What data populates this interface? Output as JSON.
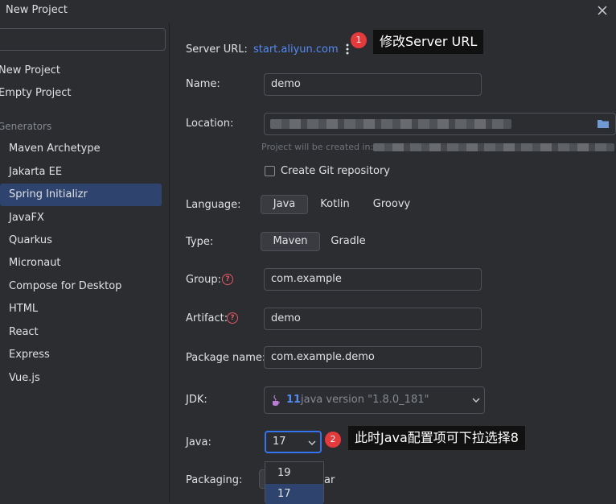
{
  "window": {
    "title": "New Project"
  },
  "sidebar": {
    "top_items": [
      "New Project",
      "Empty Project"
    ],
    "generators_label": "Generators",
    "generators": [
      "Maven Archetype",
      "Jakarta EE",
      "Spring Initializr",
      "JavaFX",
      "Quarkus",
      "Micronaut",
      "Compose for Desktop",
      "HTML",
      "React",
      "Express",
      "Vue.js"
    ],
    "selected": "Spring Initializr"
  },
  "form": {
    "server_url_label": "Server URL:",
    "server_url_value": "start.aliyun.com",
    "name_label": "Name:",
    "name_value": "demo",
    "location_label": "Location:",
    "location_hint": "Project will be created in:",
    "git_label": "Create Git repository",
    "language_label": "Language:",
    "languages": [
      "Java",
      "Kotlin",
      "Groovy"
    ],
    "language_selected": "Java",
    "type_label": "Type:",
    "types": [
      "Maven",
      "Gradle"
    ],
    "type_selected": "Maven",
    "group_label": "Group:",
    "group_value": "com.example",
    "artifact_label": "Artifact:",
    "artifact_value": "demo",
    "package_label": "Package name:",
    "package_value": "com.example.demo",
    "jdk_label": "JDK:",
    "jdk_version": "11",
    "jdk_detail": "java version \"1.8.0_181\"",
    "java_label": "Java:",
    "java_value": "17",
    "java_options": [
      "19",
      "17"
    ],
    "packaging_label": "Packaging:",
    "packaging_partial": "ar"
  },
  "annotations": [
    {
      "number": "1",
      "text": "修改Server URL"
    },
    {
      "number": "2",
      "text": "此时Java配置项可下拉选择8"
    }
  ],
  "colors": {
    "accent": "#548af7",
    "selection": "#2e436e",
    "badge": "#e5393b"
  }
}
